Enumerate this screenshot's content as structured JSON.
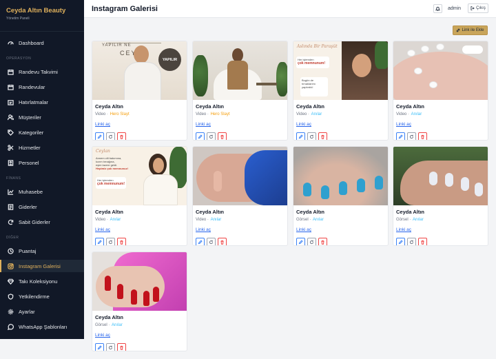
{
  "brand": {
    "title": "Ceyda Altın Beauty",
    "subtitle": "Yönetim Paneli"
  },
  "nav": {
    "dashboard": "Dashboard",
    "section_operasyon": "OPERASYON",
    "randevu_takvimi": "Randevu Takvimi",
    "randevular": "Randevular",
    "hatirlatmalar": "Hatırlatmalar",
    "musteriler": "Müşteriler",
    "kategoriler": "Kategoriler",
    "hizmetler": "Hizmetler",
    "personel": "Personel",
    "section_finans": "FİNANS",
    "muhasebe": "Muhasebe",
    "giderler": "Giderler",
    "sabit_giderler": "Sabit Giderler",
    "section_diger": "DİĞER",
    "puantaj": "Puantaj",
    "instagram_galerisi": "Instagram Galerisi",
    "taki_koleksiyonu": "Takı Koleksiyonu",
    "yetkilendirme": "Yetkilendirme",
    "ayarlar": "Ayarlar",
    "whatsapp_sablonlari": "WhatsApp Şablonları"
  },
  "header": {
    "title": "Instagram Galerisi",
    "user": "admin",
    "logout": "Çıkış"
  },
  "toolbar": {
    "add_link": "Link ile Ekle"
  },
  "colors": {
    "accent": "#e0b15c",
    "sidebar_bg": "#111827",
    "cat_hero": "#f59e0b",
    "cat_anilar": "#38bdf8",
    "link": "#2563eb"
  },
  "cards": [
    {
      "name": "Ceyda Altın",
      "type": "Video",
      "sep": " · ",
      "category": "Hero Slayt",
      "link": "Linki aç",
      "thumb": "portrait-studio"
    },
    {
      "name": "Ceyda Altın",
      "type": "Video",
      "sep": " · ",
      "category": "Hero Slayt",
      "link": "Linki aç",
      "thumb": "seated-woman"
    },
    {
      "name": "Ceyda Altın",
      "type": "Video",
      "sep": " · ",
      "category": "Anılar",
      "link": "Linki aç",
      "thumb": "text-promo",
      "overlay": {
        "l1": "Aslında Bir Paraşüt",
        "l2": "Her işlemden",
        "l3": "çok memnunum!",
        "l4": "Bugün de",
        "l5": "tırnaklarımı",
        "l6": "yaptırdık!"
      }
    },
    {
      "name": "Ceyda Altın",
      "type": "Video",
      "sep": " · ",
      "category": "Anılar",
      "link": "Linki aç",
      "thumb": "toes"
    },
    {
      "name": "Ceyda Altın",
      "type": "Video",
      "sep": " · ",
      "category": "Anılar",
      "link": "Linki aç",
      "thumb": "text-promo-2",
      "overlay": {
        "l1": "Ceylan",
        "l2": "Annem cilt bakımına,",
        "l3": "kızım tırnağına,",
        "l4": "eşim lazere geldi.",
        "l5": "Hepimiz çok memnunuz!",
        "l6": "Her işlemden",
        "l7": "çok memnunum!"
      }
    },
    {
      "name": "Ceyda Altın",
      "type": "Video",
      "sep": " · ",
      "category": "Anılar",
      "link": "Linki aç",
      "thumb": "gloves"
    },
    {
      "name": "Ceyda Altın",
      "type": "Görsel",
      "sep": " · ",
      "category": "Anılar",
      "link": "Linki aç",
      "thumb": "blue-nails"
    },
    {
      "name": "Ceyda Altın",
      "type": "Görsel",
      "sep": " · ",
      "category": "Anılar",
      "link": "Linki aç",
      "thumb": "white-nails"
    },
    {
      "name": "Ceyda Altın",
      "type": "Görsel",
      "sep": " · ",
      "category": "Anılar",
      "link": "Linki aç",
      "thumb": "red-nails-pink-glove"
    }
  ],
  "thumb_text": {
    "yapilir": "YAPILIR",
    "ceyda_logo": "CEYDA",
    "yapilir_top": "YAPILIR NE"
  }
}
